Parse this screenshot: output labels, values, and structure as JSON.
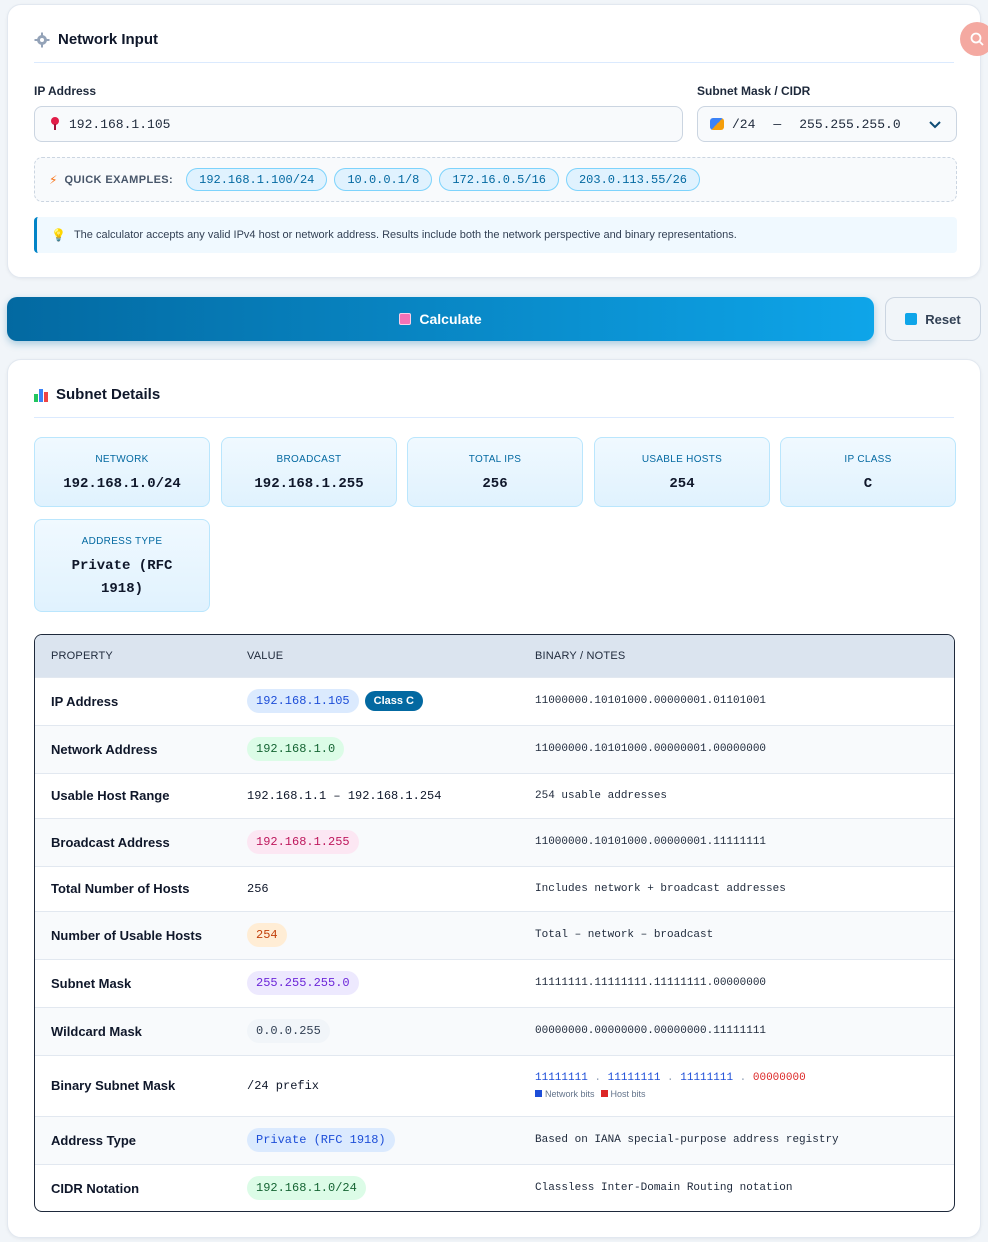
{
  "input_card": {
    "title": "Network Input",
    "ip_label": "IP Address",
    "ip_value": "192.168.1.105",
    "mask_label": "Subnet Mask / CIDR",
    "mask_cidr": "/24",
    "mask_sep": "—",
    "mask_dotted": "255.255.255.0",
    "quick_label": "QUICK EXAMPLES:",
    "quick_examples": [
      "192.168.1.100/24",
      "10.0.0.1/8",
      "172.16.0.5/16",
      "203.0.113.55/26"
    ],
    "note": "The calculator accepts any valid IPv4 host or network address. Results include both the network perspective and binary representations."
  },
  "buttons": {
    "calculate": "Calculate",
    "reset": "Reset"
  },
  "details": {
    "title": "Subnet Details",
    "stats": [
      {
        "label": "NETWORK",
        "value": "192.168.1.0/24"
      },
      {
        "label": "BROADCAST",
        "value": "192.168.1.255"
      },
      {
        "label": "TOTAL IPS",
        "value": "256"
      },
      {
        "label": "USABLE HOSTS",
        "value": "254"
      },
      {
        "label": "IP CLASS",
        "value": "C"
      },
      {
        "label": "ADDRESS TYPE",
        "value": "Private (RFC 1918)"
      }
    ],
    "table": {
      "headers": [
        "PROPERTY",
        "VALUE",
        "BINARY / NOTES"
      ],
      "rows": [
        {
          "property": "IP Address",
          "value": "192.168.1.105",
          "badge": "Class C",
          "notes": "11000000.10101000.00000001.01101001"
        },
        {
          "property": "Network Address",
          "value": "192.168.1.0",
          "notes": "11000000.10101000.00000001.00000000"
        },
        {
          "property": "Usable Host Range",
          "value": "192.168.1.1 – 192.168.1.254",
          "notes": "254 usable addresses"
        },
        {
          "property": "Broadcast Address",
          "value": "192.168.1.255",
          "notes": "11000000.10101000.00000001.11111111"
        },
        {
          "property": "Total Number of Hosts",
          "value": "256",
          "notes": "Includes network + broadcast addresses"
        },
        {
          "property": "Number of Usable Hosts",
          "value": "254",
          "notes": "Total – network – broadcast"
        },
        {
          "property": "Subnet Mask",
          "value": "255.255.255.0",
          "notes": "11111111.11111111.11111111.00000000"
        },
        {
          "property": "Wildcard Mask",
          "value": "0.0.0.255",
          "notes": "00000000.00000000.00000000.11111111"
        },
        {
          "property": "Binary Subnet Mask",
          "value": "/24 prefix",
          "notes_net": [
            "11111111",
            "11111111",
            "11111111"
          ],
          "notes_host": "00000000",
          "legend_net": "Network bits",
          "legend_host": "Host bits"
        },
        {
          "property": "Address Type",
          "value": "Private (RFC 1918)",
          "notes": "Based on IANA special-purpose address registry"
        },
        {
          "property": "CIDR Notation",
          "value": "192.168.1.0/24",
          "notes": "Classless Inter-Domain Routing notation"
        }
      ]
    }
  }
}
